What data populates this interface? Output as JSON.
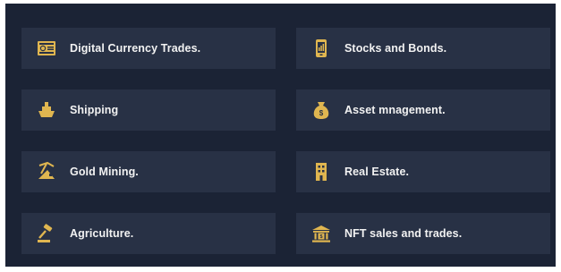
{
  "accent_color": "#e0b650",
  "card_color": "#283145",
  "panel_color": "#1b2335",
  "cards": [
    {
      "label": "Digital Currency Trades.",
      "icon": "money-stack-icon"
    },
    {
      "label": "Stocks and Bonds.",
      "icon": "mobile-phone-icon"
    },
    {
      "label": "Shipping",
      "icon": "ship-icon"
    },
    {
      "label": "Asset mnagement.",
      "icon": "money-bag-icon"
    },
    {
      "label": "Gold Mining.",
      "icon": "mining-icon"
    },
    {
      "label": "Real Estate.",
      "icon": "building-icon"
    },
    {
      "label": "Agriculture.",
      "icon": "gavel-icon"
    },
    {
      "label": "NFT sales and trades.",
      "icon": "bank-icon"
    }
  ]
}
